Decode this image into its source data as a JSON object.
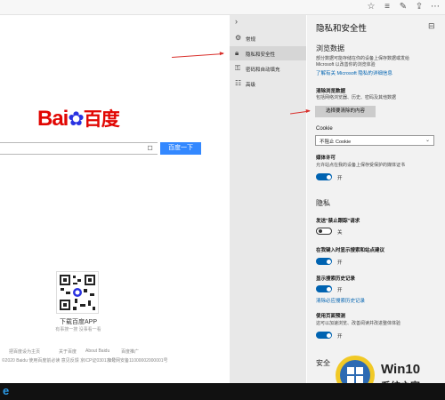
{
  "toolbar": {
    "icons": [
      "favorite-icon",
      "reading-list-icon",
      "pen-icon",
      "share-icon",
      "more-icon"
    ]
  },
  "baidu": {
    "logo_latin": "Bai",
    "logo_cn": "百度",
    "search_button": "百度一下",
    "app_label": "下载百度APP",
    "app_sub": "有事搜一搜 没事看一看",
    "footer_links": [
      "把百度设为主页",
      "关于百度",
      "About  Baidu",
      "百度推广"
    ],
    "footer_copyright": "©2020 Baidu  使用百度前必读  意见反馈  京ICP证030173号",
    "footer_police": "京公网安备11000002000001号"
  },
  "nav": {
    "collapse": "›",
    "items": [
      {
        "label": "常规",
        "icon": "gear-icon"
      },
      {
        "label": "隐私和安全性",
        "icon": "lock-icon"
      },
      {
        "label": "密码和自动填充",
        "icon": "key-icon"
      },
      {
        "label": "高级",
        "icon": "sliders-icon"
      }
    ]
  },
  "panel": {
    "title": "隐私和安全性",
    "browsing_data": {
      "heading": "浏览数据",
      "desc1": "部分数据可能存储在你的设备上保存数据或发给",
      "desc2": "Microsoft 以改善你的浏览体验",
      "link": "了解有关 Microsoft 隐私的详细信息",
      "clear_title": "清除浏览数据",
      "clear_desc": "包括网络浏览器、历史、密码及其他数据",
      "clear_button": "选择要清除的内容"
    },
    "cookie": {
      "label": "Cookie",
      "value": "不阻止 Cookie"
    },
    "media": {
      "title": "媒体许可",
      "desc": "允许站点在我的设备上保存受保护的媒体证书",
      "state": "开"
    },
    "privacy": {
      "heading": "隐私",
      "dnt_title": "发送\"禁止跟踪\"请求",
      "dnt_state": "关",
      "search_title": "在我键入时显示搜索和站点建议",
      "search_state": "开",
      "history_title": "显示搜索历史记录",
      "history_link": "清除必应搜索历史记录",
      "history_state": "开",
      "predict_title": "使用页面预测",
      "predict_desc": "这可以加速浏览、改善阅读并改进整体体验",
      "predict_state": "开"
    },
    "security_heading": "安全",
    "watermark": {
      "brand": "Win10",
      "sub": "系统之家"
    }
  },
  "colors": {
    "accent": "#0063b1",
    "baidu_red": "#e10602",
    "baidu_blue": "#2932e1",
    "annotation_red": "#d9302c"
  }
}
